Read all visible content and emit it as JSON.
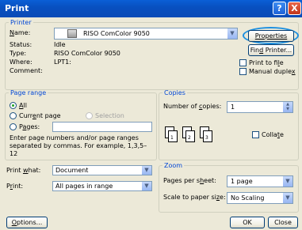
{
  "title": "Print",
  "titlebar": {
    "help": "?",
    "close": "X"
  },
  "printer": {
    "legend": "Printer",
    "name_label": "Name:",
    "name_value": "RISO ComColor 9050",
    "status_label": "Status:",
    "status_value": "Idle",
    "type_label": "Type:",
    "type_value": "RISO ComColor 9050",
    "where_label": "Where:",
    "where_value": "LPT1:",
    "comment_label": "Comment:",
    "properties": "Properties",
    "find_printer": "Find Printer...",
    "print_to_file": "Print to file",
    "manual_duplex": "Manual duplex"
  },
  "page_range": {
    "legend": "Page range",
    "all": "All",
    "current_page": "Current page",
    "selection": "Selection",
    "pages": "Pages:",
    "pages_value": "",
    "hint": "Enter page numbers and/or page ranges separated by commas. For example, 1,3,5–12"
  },
  "copies": {
    "legend": "Copies",
    "number_label": "Number of copies:",
    "number_value": "1",
    "collate": "Collate",
    "page_digits": [
      "1",
      "2",
      "3"
    ]
  },
  "print_what": {
    "label": "Print what:",
    "value": "Document"
  },
  "print": {
    "label": "Print:",
    "value": "All pages in range"
  },
  "zoom": {
    "legend": "Zoom",
    "pps_label": "Pages per sheet:",
    "pps_value": "1 page",
    "scale_label": "Scale to paper size:",
    "scale_value": "No Scaling"
  },
  "buttons": {
    "options": "Options...",
    "ok": "OK",
    "close": "Close"
  },
  "colors": {
    "highlight_circle": "#1E90E0"
  }
}
